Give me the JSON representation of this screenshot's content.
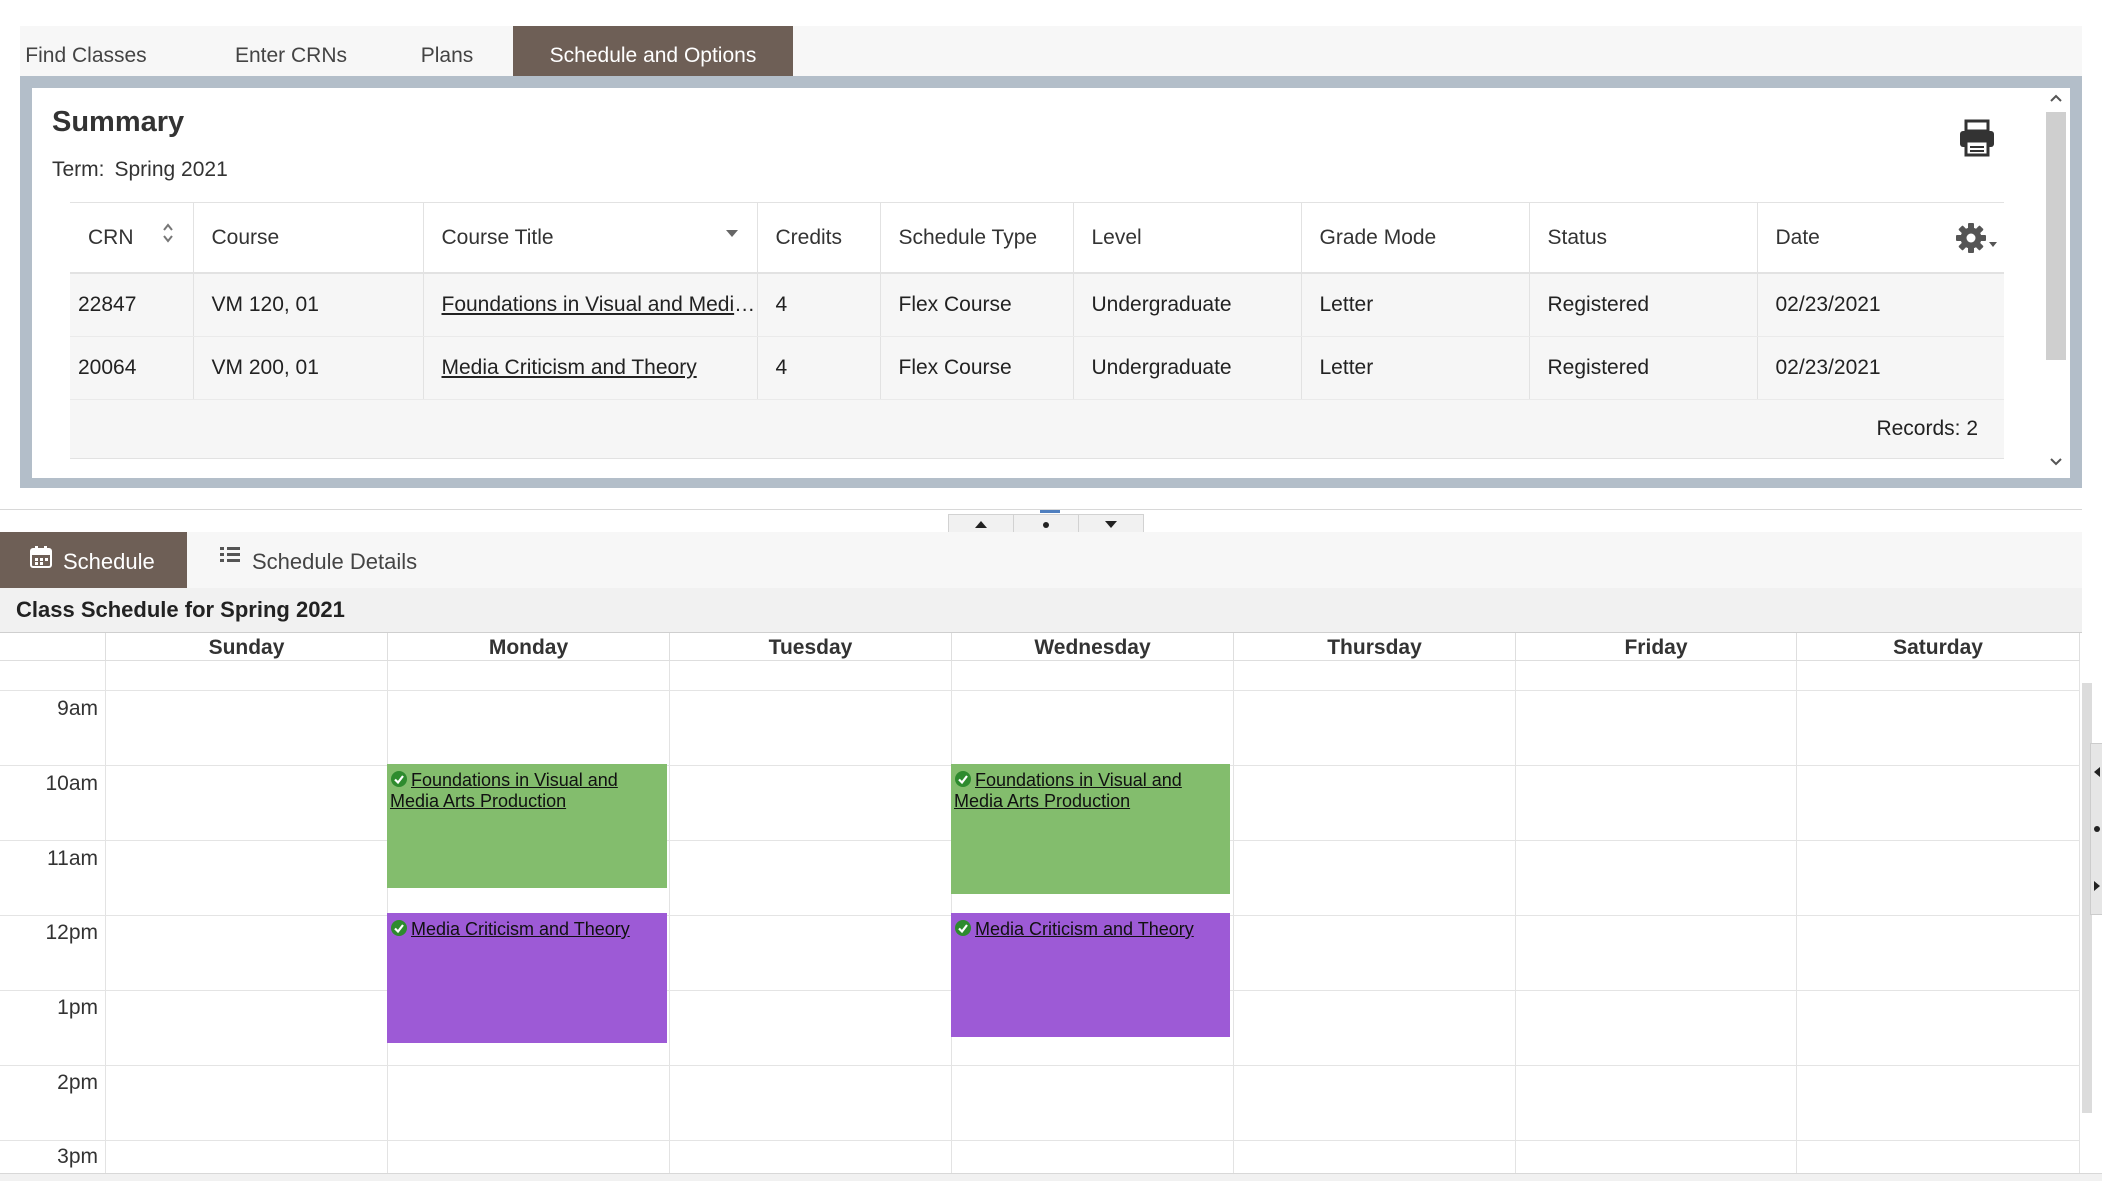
{
  "top_tabs": [
    {
      "label": "Find Classes"
    },
    {
      "label": "Enter CRNs"
    },
    {
      "label": "Plans"
    },
    {
      "label": "Schedule and Options"
    }
  ],
  "summary": {
    "title": "Summary",
    "term_label": "Term:",
    "term_value": "Spring 2021",
    "columns": [
      "CRN",
      "Course",
      "Course Title",
      "Credits",
      "Schedule Type",
      "Level",
      "Grade Mode",
      "Status",
      "Date"
    ],
    "rows": [
      {
        "crn": "22847",
        "course": "VM 120, 01",
        "title": "Foundations in Visual and Media Arts Production",
        "credits": "4",
        "schedule_type": "Flex Course",
        "level": "Undergraduate",
        "grade_mode": "Letter",
        "status": "Registered",
        "date": "02/23/2021"
      },
      {
        "crn": "20064",
        "course": "VM 200, 01",
        "title": "Media Criticism and Theory",
        "credits": "4",
        "schedule_type": "Flex Course",
        "level": "Undergraduate",
        "grade_mode": "Letter",
        "status": "Registered",
        "date": "02/23/2021"
      }
    ],
    "records_text": "Records: 2"
  },
  "schedule_tabs": [
    {
      "label": "Schedule",
      "icon": "calendar-icon"
    },
    {
      "label": "Schedule Details",
      "icon": "list-icon"
    }
  ],
  "calendar": {
    "heading": "Class Schedule for Spring 2021",
    "days": [
      "Sunday",
      "Monday",
      "Tuesday",
      "Wednesday",
      "Thursday",
      "Friday",
      "Saturday"
    ],
    "hours": [
      "9am",
      "10am",
      "11am",
      "12pm",
      "1pm",
      "2pm",
      "3pm"
    ],
    "events": [
      {
        "title": "Foundations in Visual and Media Arts Production",
        "day": "Monday",
        "color": "#83bd6d"
      },
      {
        "title": "Media Criticism and Theory",
        "day": "Monday",
        "color": "#9d5ad6"
      },
      {
        "title": "Foundations in Visual and Media Arts Production",
        "day": "Wednesday",
        "color": "#83bd6d"
      },
      {
        "title": "Media Criticism and Theory",
        "day": "Wednesday",
        "color": "#9d5ad6"
      }
    ]
  },
  "colors": {
    "active_tab": "#6e5f56",
    "panel_frame": "#b3bec9",
    "event_green": "#83bd6d",
    "event_purple": "#9d5ad6",
    "check_green": "#2e8b2e"
  }
}
